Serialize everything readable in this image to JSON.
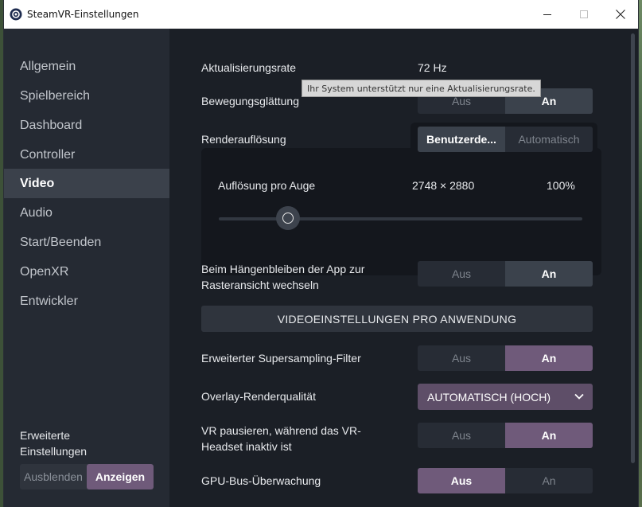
{
  "window": {
    "title": "SteamVR-Einstellungen",
    "icon": "steamvr-icon"
  },
  "sidebar": {
    "items": [
      {
        "label": "Allgemein"
      },
      {
        "label": "Spielbereich"
      },
      {
        "label": "Dashboard"
      },
      {
        "label": "Controller"
      },
      {
        "label": "Video",
        "active": true
      },
      {
        "label": "Audio"
      },
      {
        "label": "Start/Beenden"
      },
      {
        "label": "OpenXR"
      },
      {
        "label": "Entwickler"
      }
    ],
    "advanced_label": "Erweiterte Einstellungen",
    "advanced_hide": "Ausblenden",
    "advanced_show": "Anzeigen"
  },
  "settings": {
    "refresh_rate_label": "Aktualisierungsrate",
    "refresh_rate_value": "72 Hz",
    "refresh_tooltip": "Ihr System unterstützt nur eine Aktualisierungsrate.",
    "motion_smoothing_label": "Bewegungsglättung",
    "motion_smoothing_off": "Aus",
    "motion_smoothing_on": "An",
    "render_resolution_label": "Renderauflösung",
    "render_custom": "Benutzerde...",
    "render_auto": "Automatisch",
    "res_per_eye_label": "Auflösung pro Auge",
    "res_per_eye_value": "2748 × 2880",
    "res_percent": "100%",
    "res_slider_fraction": 0.19,
    "hang_label": "Beim Hängenbleiben der App zur Rasteransicht wechseln",
    "hang_off": "Aus",
    "hang_on": "An",
    "per_app_button": "VIDEOEINSTELLUNGEN PRO ANWENDUNG",
    "supersampling_label": "Erweiterter Supersampling-Filter",
    "supersampling_off": "Aus",
    "supersampling_on": "An",
    "overlay_label": "Overlay-Renderqualität",
    "overlay_value": "AUTOMATISCH (HOCH)",
    "pause_label": "VR pausieren, während das VR-Headset inaktiv ist",
    "pause_off": "Aus",
    "pause_on": "An",
    "gpu_label": "GPU-Bus-Überwachung",
    "gpu_off": "Aus",
    "gpu_on": "An"
  },
  "colors": {
    "accent_purple": "#6f5a7a",
    "selected_dark": "#3b424c",
    "background": "#1b1f26",
    "sidebar": "#252a33"
  }
}
